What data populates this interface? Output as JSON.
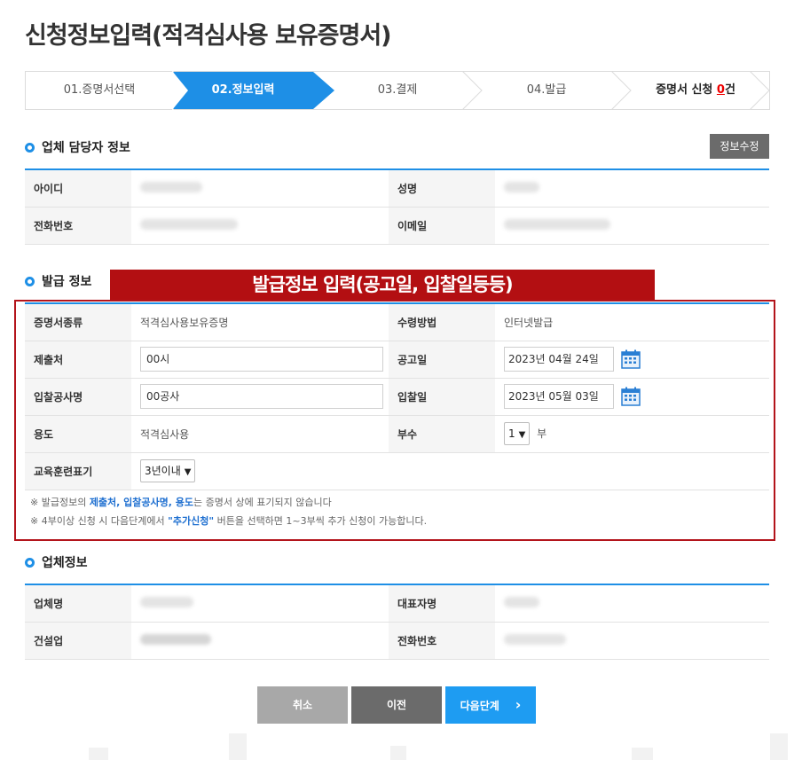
{
  "page_title": "신청정보입력(적격심사용 보유증명서)",
  "stepper": {
    "steps": [
      "01.증명서선택",
      "02.정보입력",
      "03.결제",
      "04.발급"
    ],
    "active_index": 1,
    "request_label": "증명서 신청 ",
    "request_count": "0",
    "request_unit": "건"
  },
  "contact_section": {
    "title": "업체 담당자 정보",
    "edit_button": "정보수정",
    "rows": [
      {
        "label1": "아이디",
        "label2": "성명"
      },
      {
        "label1": "전화번호",
        "label2": "이메일"
      }
    ]
  },
  "issue_section": {
    "title": "발급 정보",
    "banner": "발급정보 입력(공고일, 입찰일등등)",
    "cert_type_label": "증명서종류",
    "cert_type_value": "적격심사용보유증명",
    "receive_label": "수령방법",
    "receive_value": "인터넷발급",
    "submit_to_label": "제출처",
    "submit_to_value": "00시",
    "notice_date_label": "공고일",
    "notice_date_value": "2023년 04월 24일",
    "bid_name_label": "입찰공사명",
    "bid_name_value": "00공사",
    "bid_date_label": "입찰일",
    "bid_date_value": "2023년 05월 03일",
    "usage_label": "용도",
    "usage_value": "적격심사용",
    "copies_label": "부수",
    "copies_value": "1",
    "copies_unit": "부",
    "training_label": "교육훈련표기",
    "training_value": "3년이내"
  },
  "notes": {
    "line1_prefix": "※ 발급정보의 ",
    "line1_highlight": "제출처, 입찰공사명, 용도",
    "line1_suffix": "는 증명서 상에 표기되지 않습니다",
    "line2_prefix": "※ 4부이상 신청 시 다음단계에서 ",
    "line2_highlight": "\"추가신청\"",
    "line2_suffix": " 버튼을 선택하면 1~3부씩 추가 신청이 가능합니다."
  },
  "company_section": {
    "title": "업체정보",
    "rows": [
      {
        "label1": "업체명",
        "label2": "대표자명"
      },
      {
        "label1": "건설업",
        "label2": "전화번호"
      }
    ]
  },
  "buttons": {
    "cancel": "취소",
    "prev": "이전",
    "next": "다음단계",
    "next_arrow": "›"
  },
  "colors": {
    "accent": "#1e8fe6",
    "banner": "#b30f12",
    "highlight": "#1e6fd0"
  }
}
